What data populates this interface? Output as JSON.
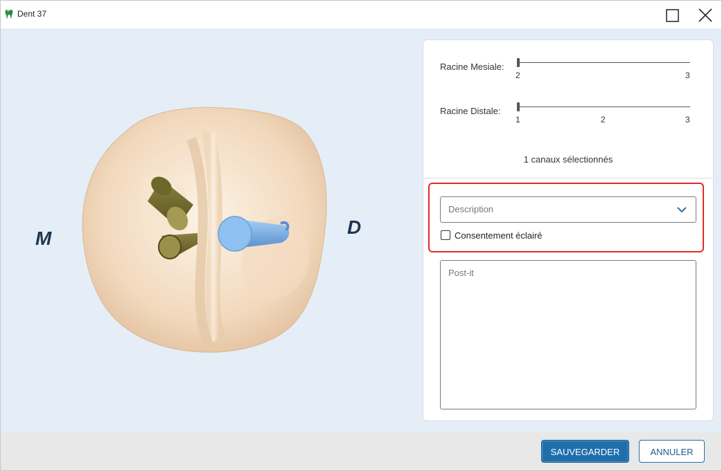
{
  "window": {
    "title": "Dent 37",
    "icon": "tooth-app-icon",
    "maximize_icon": "maximize-icon",
    "close_icon": "close-icon"
  },
  "viewer": {
    "label_left": "M",
    "label_right": "D"
  },
  "sliders": [
    {
      "label": "Racine Mesiale:",
      "ticks": [
        "2",
        "3"
      ],
      "value": "2"
    },
    {
      "label": "Racine Distale:",
      "ticks": [
        "1",
        "2",
        "3"
      ],
      "value": "1"
    }
  ],
  "canaux_text": "1 canaux sélectionnés",
  "description": {
    "placeholder": "Description",
    "icon": "chevron-down-icon"
  },
  "consentement": {
    "label": "Consentement éclairé",
    "checked": false
  },
  "postit": {
    "placeholder": "Post-it"
  },
  "buttons": {
    "save": "SAUVEGARDER",
    "cancel": "ANNULER"
  },
  "colors": {
    "accent": "#1f6fad",
    "highlight": "#e12a2a",
    "background": "#e5eef6"
  }
}
